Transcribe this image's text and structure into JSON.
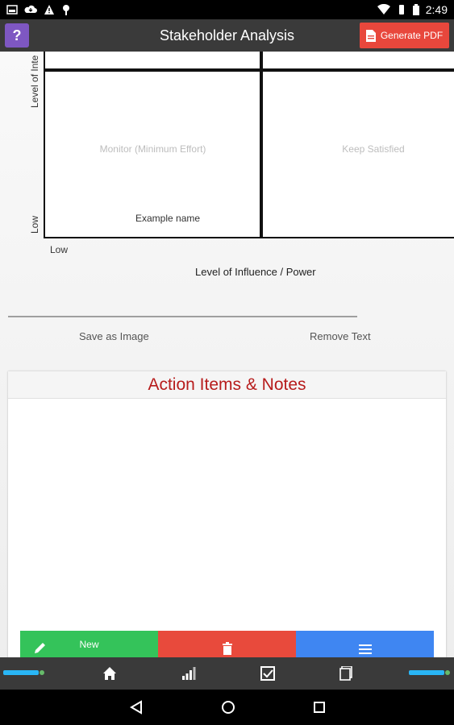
{
  "status_bar": {
    "time": "2:49"
  },
  "app_bar": {
    "help_label": "?",
    "title": "Stakeholder Analysis",
    "pdf_button_label": "Generate PDF"
  },
  "grid": {
    "y_axis_high": "Level of Inte",
    "y_axis_low": "Low",
    "x_axis_low": "Low",
    "x_axis_title": "Level of Influence / Power",
    "quadrants": {
      "bottom_left": "Monitor (Minimum Effort)",
      "bottom_right": "Keep Satisfied"
    },
    "example_name": "Example name"
  },
  "actions": {
    "save_image": "Save as Image",
    "remove_text": "Remove Text"
  },
  "notes_card": {
    "title": "Action Items & Notes",
    "new_label": "New"
  },
  "colors": {
    "help": "#7e57c2",
    "generate_pdf": "#e8473c",
    "new": "#34c35a",
    "delete": "#e84a3c",
    "menu": "#3f86f2",
    "notes_title": "#b71c1c"
  },
  "icons": {
    "bottom_nav": [
      "home-icon",
      "signal-chart-icon",
      "checkbox-icon",
      "document-icon"
    ],
    "system_nav": [
      "back-icon",
      "home-circle-icon",
      "recents-icon"
    ]
  }
}
